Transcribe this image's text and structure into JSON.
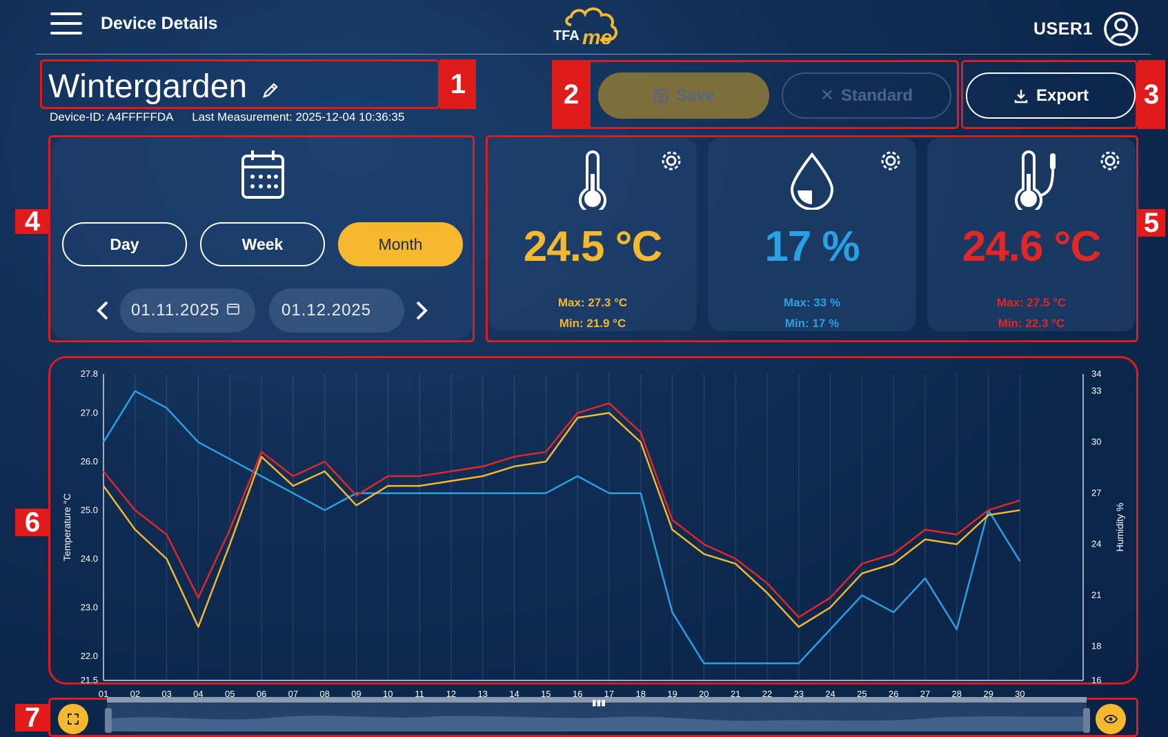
{
  "header": {
    "title": "Device Details",
    "logo_text": "TFA me",
    "user": "USER1"
  },
  "device": {
    "name": "Wintergarden",
    "device_id": "Device-ID: A4FFFFFDA",
    "last_measurement": "Last Measurement: 2025-12-04 10:36:35"
  },
  "actions": {
    "save_label": "Save",
    "standard_label": "Standard",
    "export_label": "Export"
  },
  "annotations": [
    "1",
    "2",
    "3",
    "4",
    "5",
    "6",
    "7"
  ],
  "period": {
    "options": [
      "Day",
      "Week",
      "Month"
    ],
    "selected": "Month",
    "from_date": "01.11.2025",
    "to_date": "01.12.2025"
  },
  "sensors": [
    {
      "icon": "thermometer-icon",
      "value": "24.5 °C",
      "max": "Max: 27.3 °C",
      "min": "Min: 21.9 °C",
      "color": "#f5b82e"
    },
    {
      "icon": "droplet-icon",
      "value": "17 %",
      "max": "Max: 33 %",
      "min": "Min: 17 %",
      "color": "#2aa1e4"
    },
    {
      "icon": "probe-thermometer-icon",
      "value": "24.6 °C",
      "max": "Max: 27.5 °C",
      "min": "Min: 22.3 °C",
      "color": "#e32626"
    }
  ],
  "colors": {
    "accent": "#f5b82e",
    "humidity": "#2aa1e4",
    "probe": "#e32626",
    "annotation": "#e01b1b"
  },
  "chart_data": {
    "type": "line",
    "ylabel_left": "Temperature °C",
    "ylabel_right": "Humidity %",
    "ylim_left": [
      21.5,
      27.8
    ],
    "ylim_right": [
      16,
      34
    ],
    "yticks_left": [
      "27.8",
      "27.0",
      "26.0",
      "25.0",
      "24.0",
      "23.0",
      "22.0",
      "21.5"
    ],
    "yticks_right": [
      "34",
      "33",
      "30",
      "27",
      "24",
      "21",
      "18",
      "16"
    ],
    "x": [
      "01",
      "02",
      "03",
      "04",
      "05",
      "06",
      "07",
      "08",
      "09",
      "10",
      "11",
      "12",
      "13",
      "14",
      "15",
      "16",
      "17",
      "18",
      "19",
      "20",
      "21",
      "22",
      "23",
      "24",
      "25",
      "26",
      "27",
      "28",
      "29",
      "30"
    ],
    "grid": true,
    "series": [
      {
        "color": "#e32626",
        "axis": "left",
        "values": [
          25.8,
          25.0,
          24.5,
          23.2,
          24.6,
          26.2,
          25.7,
          26.0,
          25.3,
          25.7,
          25.7,
          25.8,
          25.9,
          26.1,
          26.2,
          27.0,
          27.2,
          26.6,
          24.8,
          24.3,
          24.0,
          23.5,
          22.8,
          23.2,
          23.9,
          24.1,
          24.6,
          24.5,
          25.0,
          25.2
        ]
      },
      {
        "color": "#f5b82e",
        "axis": "left",
        "values": [
          25.5,
          24.6,
          24.0,
          22.6,
          24.3,
          26.1,
          25.5,
          25.8,
          25.1,
          25.5,
          25.5,
          25.6,
          25.7,
          25.9,
          26.0,
          26.9,
          27.0,
          26.4,
          24.6,
          24.1,
          23.9,
          23.3,
          22.6,
          23.0,
          23.7,
          23.9,
          24.4,
          24.3,
          24.9,
          25.0
        ]
      },
      {
        "color": "#2aa1e4",
        "axis": "right",
        "values": [
          30,
          33,
          32,
          30,
          29,
          28,
          27,
          26,
          27,
          27,
          27,
          27,
          27,
          27,
          27,
          28,
          27,
          27,
          20,
          17,
          17,
          17,
          17,
          19,
          21,
          20,
          22,
          19,
          26,
          23
        ]
      }
    ]
  },
  "range_slider": {
    "left_button_icon": "fullscreen-icon",
    "right_button_icon": "eye-icon"
  }
}
